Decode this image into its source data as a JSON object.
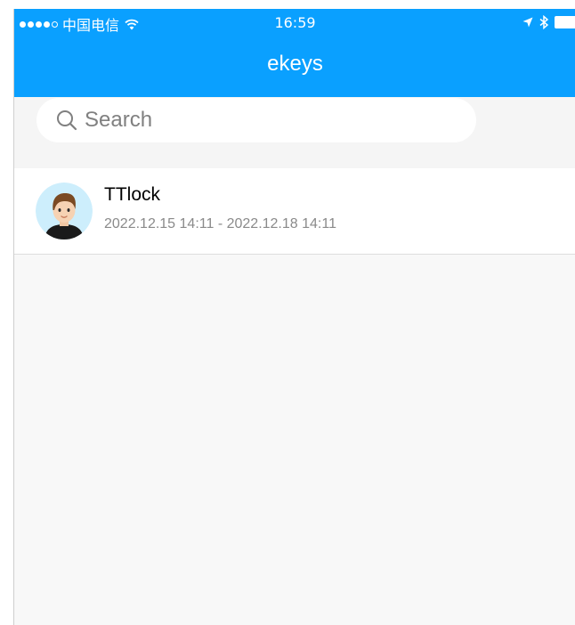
{
  "status_bar": {
    "carrier": "中国电信",
    "time": "16:59",
    "signal_strength": 4,
    "signal_max": 5
  },
  "nav": {
    "title": "ekeys"
  },
  "search": {
    "placeholder": "Search"
  },
  "ekeys": [
    {
      "name": "TTlock",
      "date_range": "2022.12.15 14:11 - 2022.12.18 14:11"
    }
  ],
  "colors": {
    "accent": "#0aa0ff",
    "background": "#f8f8f8",
    "secondary_text": "#8a8a8a"
  }
}
